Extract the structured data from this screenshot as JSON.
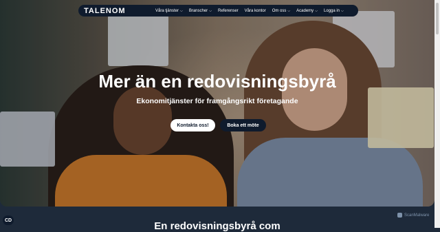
{
  "nav": {
    "logo": "TALENOM",
    "items": [
      {
        "label": "Våra tjänster",
        "dropdown": true
      },
      {
        "label": "Branscher",
        "dropdown": true
      },
      {
        "label": "Referenser",
        "dropdown": false
      },
      {
        "label": "Våra kontor",
        "dropdown": false
      },
      {
        "label": "Om oss",
        "dropdown": true
      },
      {
        "label": "Academy",
        "dropdown": true
      },
      {
        "label": "Logga in",
        "dropdown": true
      }
    ]
  },
  "hero": {
    "title": "Mer än en redovisningsbyrå",
    "subtitle": "Ekonomitjänster för framgångsrikt företagande",
    "cta_primary": "Kontakta oss!",
    "cta_secondary": "Boka ett möte"
  },
  "section": {
    "title": "En redovisningsbyrå com"
  },
  "cookie_label": "CD",
  "watermark": "ScanMalware",
  "colors": {
    "nav_bg": "#0f1b2d",
    "page_bg": "#1e2a3a",
    "accent_orange": "#c8782b"
  },
  "icons": {
    "chevron": "chevron-down-icon",
    "cookie": "cookie-icon",
    "watermark": "scanmalware-icon"
  }
}
